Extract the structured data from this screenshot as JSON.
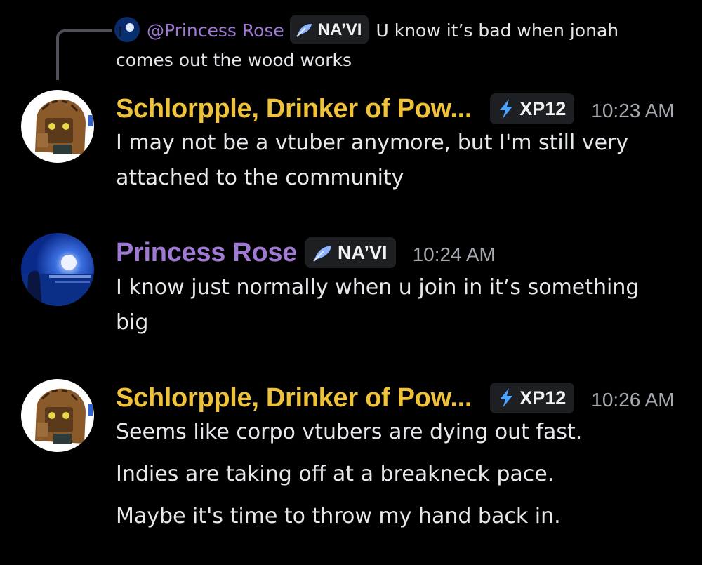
{
  "reply": {
    "mention": "@Princess Rose",
    "tag_label": "NA’VI",
    "text_line1": "U know it’s bad when jonah",
    "text_line2": "comes out the wood works"
  },
  "messages": [
    {
      "username": "Schlorpple, Drinker of Pow...",
      "username_color": "#f0c239",
      "tag_icon": "lightning-icon",
      "tag_label": "XP12",
      "time": "10:23 AM",
      "lines": [
        "I may not be a vtuber anymore, but I'm still very",
        "attached to the community"
      ]
    },
    {
      "username": "Princess Rose",
      "username_color": "#9f79d4",
      "tag_icon": "feather-icon",
      "tag_label": "NA’VI",
      "time": "10:24 AM",
      "lines": [
        "I know just normally when u join in it’s something",
        "big"
      ]
    },
    {
      "username": "Schlorpple, Drinker of Pow...",
      "username_color": "#f0c239",
      "tag_icon": "lightning-icon",
      "tag_label": "XP12",
      "time": "10:26 AM",
      "lines": [
        "Seems like corpo vtubers are dying out fast.",
        "Indies are taking off at a breakneck pace.",
        "Maybe it's time to throw my hand back in."
      ]
    }
  ]
}
